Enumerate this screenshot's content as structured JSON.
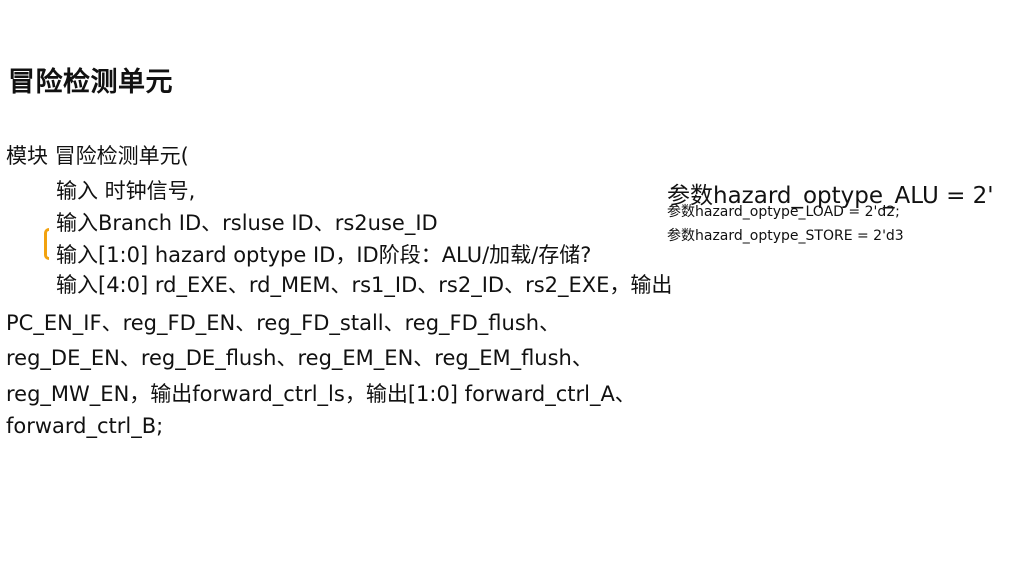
{
  "document": {
    "title": "冒险检测单元",
    "module_line": "模块 冒险检测单元(",
    "inputs": [
      "输入 时钟信号,",
      "输入Branch ID、rsluse ID、rs2use_ID",
      "输入[1:0] hazard optype ID，ID阶段：ALU/加载/存储?",
      "输入[4:0] rd_EXE、rd_MEM、rs1_ID、rs2_ID、rs2_EXE，输出"
    ],
    "outputs": [
      "PC_EN_IF、reg_FD_EN、reg_FD_stall、reg_FD_flush、",
      "reg_DE_EN、reg_DE_flush、reg_EM_EN、reg_EM_flush、",
      "reg_MW_EN，输出forward_ctrl_ls，输出[1:0] forward_ctrl_A、",
      "forward_ctrl_B;"
    ],
    "parameters": {
      "alu": "参数hazard_optype_ALU = 2'",
      "load": "参数hazard_optype_LOAD = 2'd2;",
      "store": "参数hazard_optype_STORE = 2'd3"
    }
  },
  "colors": {
    "text": "#111111",
    "accent": "#f2a20f",
    "background": "#ffffff"
  }
}
